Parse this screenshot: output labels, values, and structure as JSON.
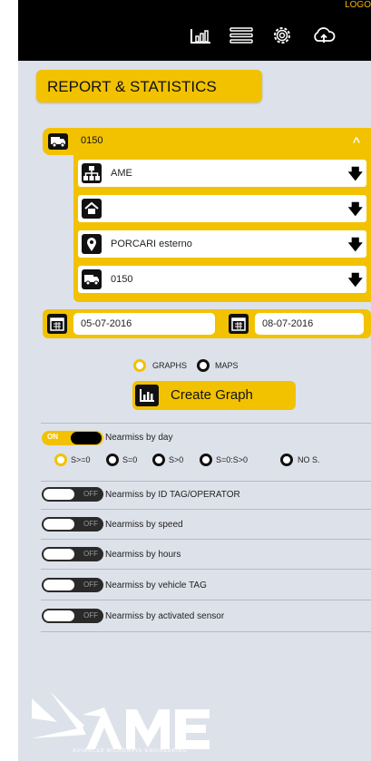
{
  "header": {
    "logo_text": "LOGO",
    "icons": [
      "bar-chart-icon",
      "list-icon",
      "gear-icon",
      "cloud-upload-icon"
    ]
  },
  "title": "REPORT & STATISTICS",
  "vehicle_section": {
    "label": "0150",
    "filters": [
      {
        "icon": "hierarchy-icon",
        "value": "AME"
      },
      {
        "icon": "home-icon",
        "value": ""
      },
      {
        "icon": "location-pin-icon",
        "value": "PORCARI esterno"
      },
      {
        "icon": "truck-icon",
        "value": "0150"
      }
    ]
  },
  "dates": {
    "from": "05-07-2016",
    "to": "08-07-2016"
  },
  "output_mode": {
    "options": [
      "GRAPHS",
      "MAPS"
    ],
    "selected": "GRAPHS"
  },
  "create_button": "Create Graph",
  "reports": [
    {
      "label": "Nearmiss by day",
      "state": "ON"
    },
    {
      "label": "Nearmiss by ID TAG/OPERATOR",
      "state": "OFF"
    },
    {
      "label": "Nearmiss by speed",
      "state": "OFF"
    },
    {
      "label": "Nearmiss by hours",
      "state": "OFF"
    },
    {
      "label": "Nearmiss by vehicle TAG",
      "state": "OFF"
    },
    {
      "label": "Nearmiss by activated sensor",
      "state": "OFF"
    }
  ],
  "day_filters": {
    "options": [
      "S>=0",
      "S=0",
      "S>0",
      "S=0:S>0",
      "NO S."
    ],
    "selected": "S>=0"
  },
  "brand": {
    "name": "AME",
    "tagline": "ADVANCED MICROWAVE ENGINEERING"
  },
  "colors": {
    "accent": "#f2c200",
    "panel_bg": "#dde1ea",
    "topbar": "#000000"
  }
}
